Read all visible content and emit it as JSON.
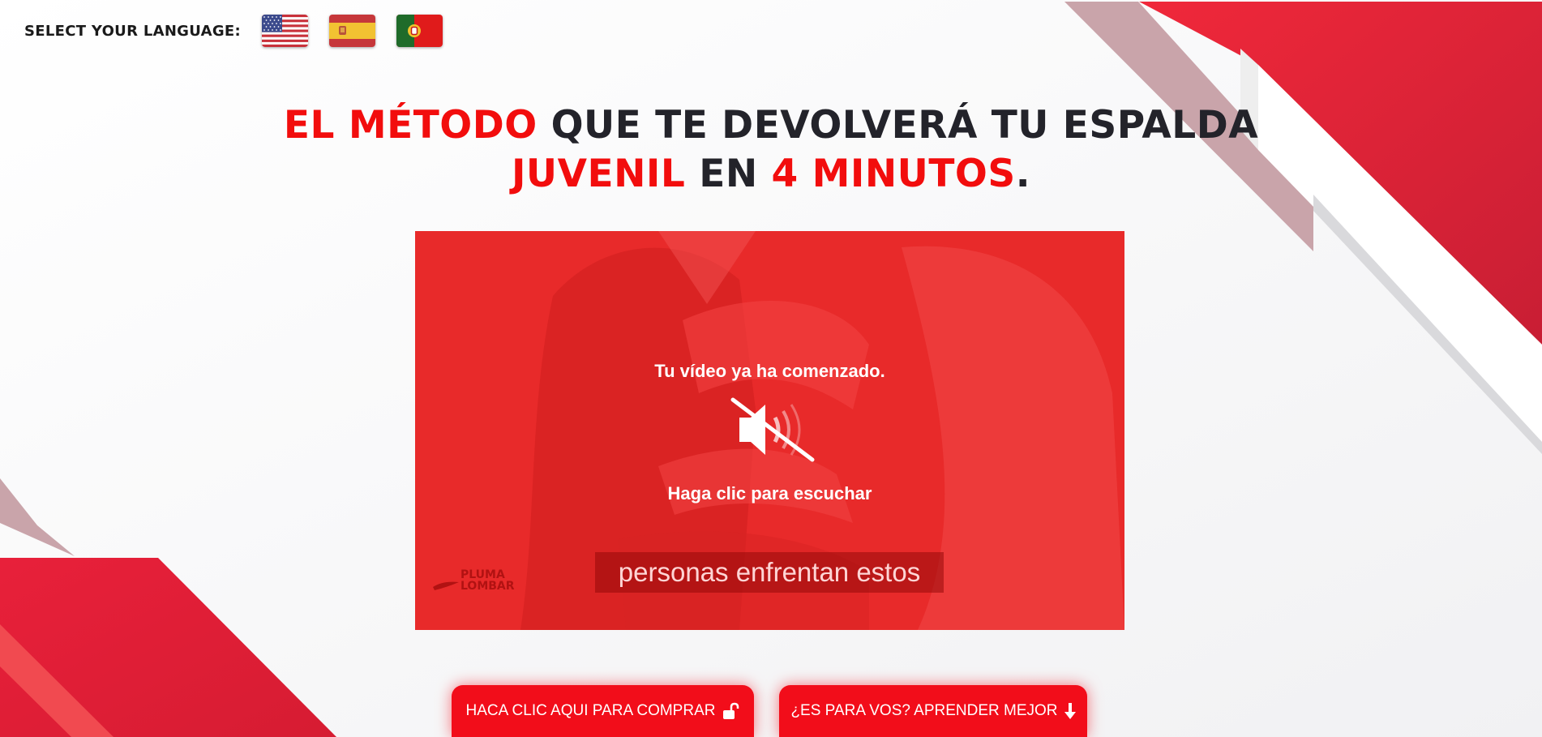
{
  "language_selector": {
    "label": "SELECT YOUR LANGUAGE:",
    "flags": [
      {
        "name": "english",
        "icon": "us-flag-icon"
      },
      {
        "name": "spanish",
        "icon": "spain-flag-icon"
      },
      {
        "name": "portuguese",
        "icon": "portugal-flag-icon"
      }
    ]
  },
  "headline": {
    "line1_red": "EL MÉTODO",
    "line1_dark": " QUE TE DEVOLVERÁ TU ESPALDA",
    "line2_red_1": "JUVENIL",
    "line2_dark_1": " EN ",
    "line2_red_2": "4 MINUTOS",
    "line2_dark_2": "."
  },
  "video": {
    "started_text": "Tu vídeo ya ha comenzado.",
    "click_text": "Haga clic para escuchar",
    "subtitle": "personas enfrentan estos",
    "logo_line1": "PLUMA",
    "logo_line2": "LOMBAR",
    "icon": "muted-speaker-icon"
  },
  "buttons": {
    "buy_label": "HACA CLIC AQUI PARA COMPRAR",
    "buy_icon": "unlock-icon",
    "learn_label": "¿ES PARA VOS? APRENDER MEJOR",
    "learn_icon": "arrow-down-icon"
  },
  "colors": {
    "accent_red": "#f20d0d",
    "headline_dark": "#23232a",
    "button_red": "#f20d1a"
  }
}
